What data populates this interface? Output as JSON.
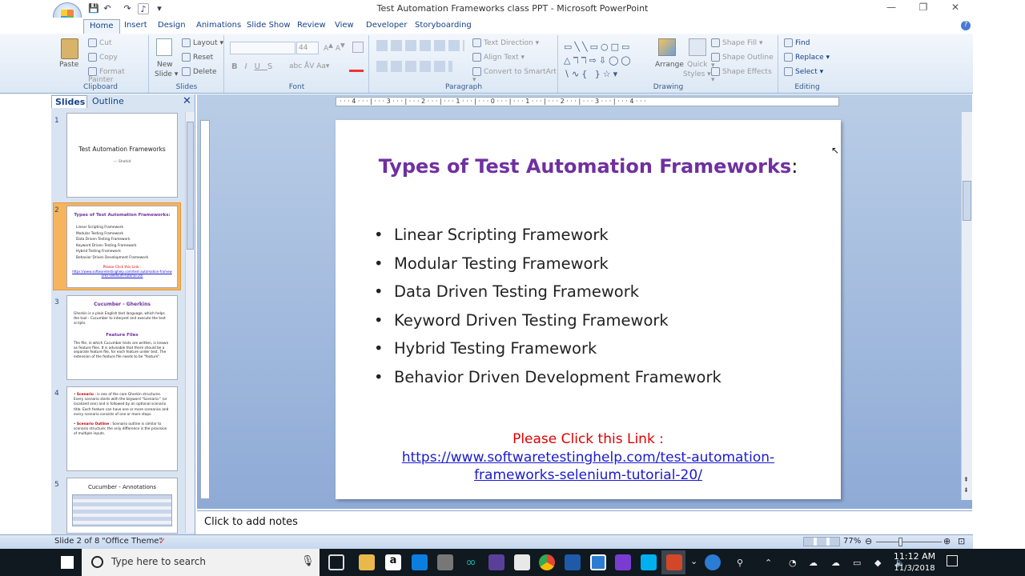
{
  "window": {
    "title": "Test Automation Frameworks class PPT - Microsoft PowerPoint"
  },
  "qat": {
    "save": "💾",
    "undo": "↶",
    "redo": "↷"
  },
  "tabs": [
    {
      "label": "Home",
      "active": true
    },
    {
      "label": "Insert"
    },
    {
      "label": "Design"
    },
    {
      "label": "Animations"
    },
    {
      "label": "Slide Show"
    },
    {
      "label": "Review"
    },
    {
      "label": "View"
    },
    {
      "label": "Developer"
    },
    {
      "label": "Storyboarding"
    }
  ],
  "ribbon": {
    "clipboard": {
      "label": "Clipboard",
      "paste": "Paste",
      "cut": "Cut",
      "copy": "Copy",
      "format_painter": "Format Painter"
    },
    "slides": {
      "label": "Slides",
      "new_slide": "New",
      "new_slide2": "Slide",
      "layout": "Layout",
      "reset": "Reset",
      "delete": "Delete"
    },
    "font": {
      "label": "Font",
      "size": "44"
    },
    "paragraph": {
      "label": "Paragraph",
      "text_direction": "Text Direction",
      "align_text": "Align Text",
      "convert": "Convert to SmartArt"
    },
    "drawing": {
      "label": "Drawing",
      "arrange": "Arrange",
      "quick": "Quick",
      "styles": "Styles",
      "shape_fill": "Shape Fill",
      "shape_outline": "Shape Outline",
      "shape_effects": "Shape Effects"
    },
    "editing": {
      "label": "Editing",
      "find": "Find",
      "replace": "Replace",
      "select": "Select"
    }
  },
  "panel": {
    "slides_tab": "Slides",
    "outline_tab": "Outline"
  },
  "thumbs": [
    {
      "num": "1",
      "title": "Test Automation Frameworks",
      "sub": "--- Shahid"
    },
    {
      "num": "2",
      "title": "Types of Test Automation Frameworks:",
      "items": [
        "Linear Scripting Framework",
        "Modular Testing Framework",
        "Data Driven Testing Framework",
        "Keyword Driven Testing Framework",
        "Hybrid Testing Framework",
        "Behavior Driven Development Framework"
      ],
      "click": "Please Click this Link :",
      "link": "https://www.softwaretestinghelp.com/test-automation-frameworks-selenium-tutorial-20/"
    },
    {
      "num": "3",
      "title": "Cucumber - Gherkins",
      "p1": "Gherkin is a plain English text language, which helps the tool - Cucumber to interpret and execute the test scripts.",
      "h2": "Feature Files",
      "p2": "The file, in which Cucumber tests are written, is known as feature files. It is advisable that there should be a separate feature file, for each feature under test. The extension of the feature file needs to be \"feature\"."
    },
    {
      "num": "4",
      "s1": "Scenario",
      "p1": ": is one of the core Gherkin structures. Every scenario starts with the keyword \"Scenario:\" (or localized one) and is followed by an optional scenario title. Each feature can have one or more scenarios and every scenario consists of one or more steps.",
      "s2": "Scenario Outline",
      "p2": ": Scenario outline is similar to scenario structure; the only difference is the provision of multiple inputs."
    },
    {
      "num": "5",
      "title": "Cucumber - Annotations"
    }
  ],
  "slide": {
    "title": "Types of Test Automation Frameworks",
    "colon": ":",
    "bullets": [
      "Linear Scripting Framework",
      "Modular Testing Framework",
      "Data Driven Testing Framework",
      "Keyword Driven Testing Framework",
      "Hybrid Testing Framework",
      "Behavior Driven Development Framework"
    ],
    "click_text": "Please Click this Link :",
    "link_line1": "https://www.softwaretestinghelp.com/test-automation-",
    "link_line2": "frameworks-selenium-tutorial-20/"
  },
  "notes": {
    "placeholder": "Click to add notes"
  },
  "status": {
    "slide": "Slide 2 of 8",
    "theme": "\"Office Theme\"",
    "zoom": "77%"
  },
  "taskbar": {
    "search_placeholder": "Type here to search",
    "time": "11:12 AM",
    "date": "11/3/2018"
  },
  "colors": {
    "title_purple": "#7030a0",
    "link_red": "#e00000",
    "link_blue": "#1a1ad0",
    "ribbon": "#dce8f5"
  }
}
